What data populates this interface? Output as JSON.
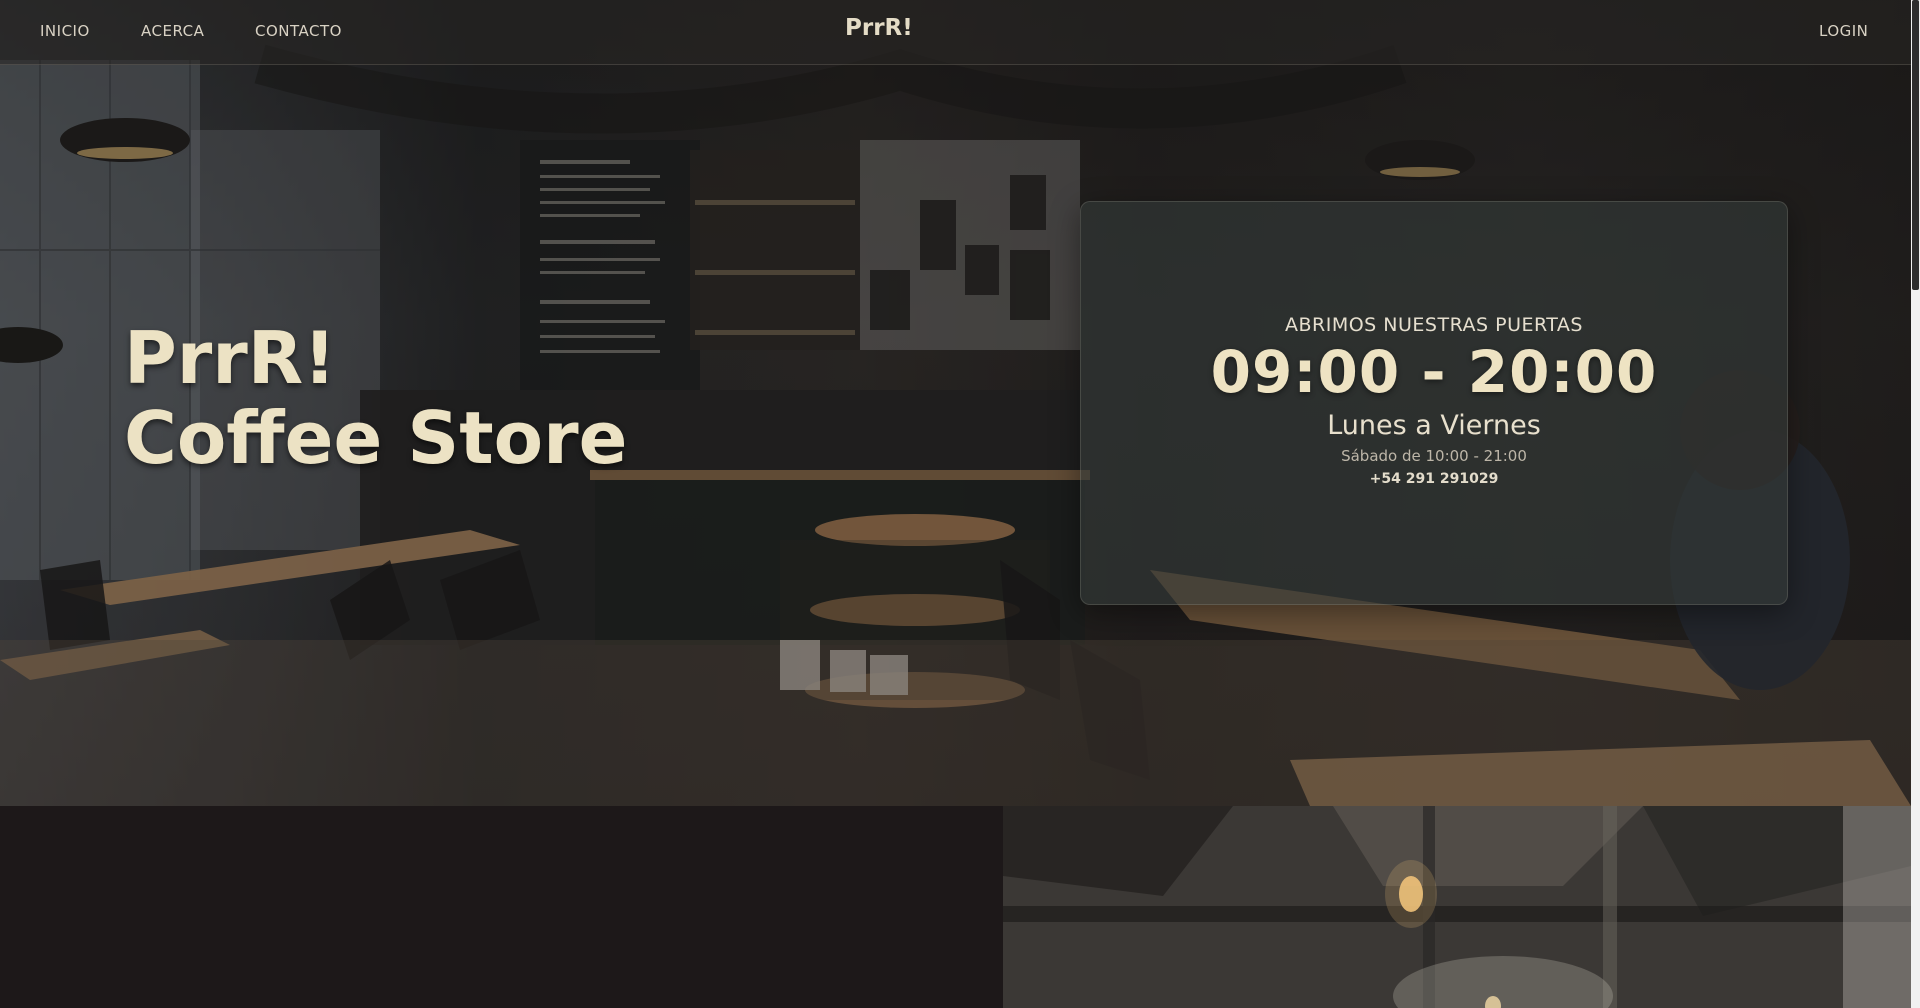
{
  "nav": {
    "links": [
      "INICIO",
      "ACERCA",
      "CONTACTO"
    ],
    "brand": "PrrR!",
    "login": "LOGIN"
  },
  "hero": {
    "title_line1": "PrrR!",
    "title_line2": "Coffee Store"
  },
  "hours": {
    "eyebrow": "ABRIMOS NUESTRAS PUERTAS",
    "time": "09:00 - 20:00",
    "days": "Lunes a Viernes",
    "saturday": "Sábado de 10:00 - 21:00",
    "phone": "+54 291 291029"
  },
  "colors": {
    "cream": "#ece2c4",
    "nav_text": "#d9d2c4",
    "dark_section": "#1d1819"
  }
}
